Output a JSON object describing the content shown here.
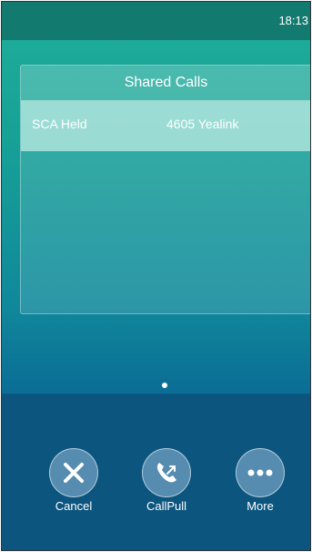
{
  "statusbar": {
    "time": "18:13"
  },
  "panel": {
    "title": "Shared Calls",
    "rows": [
      {
        "status": "SCA Held",
        "name": "4605 Yealink"
      }
    ]
  },
  "softkeys": [
    {
      "label": "Cancel",
      "icon": "close-icon"
    },
    {
      "label": "CallPull",
      "icon": "phone-handset-icon"
    },
    {
      "label": "More",
      "icon": "more-dots-icon"
    }
  ],
  "colors": {
    "statusbar": "#137a70",
    "bottom_bar": "#0b557f",
    "selected_row": "#bee8e2"
  }
}
